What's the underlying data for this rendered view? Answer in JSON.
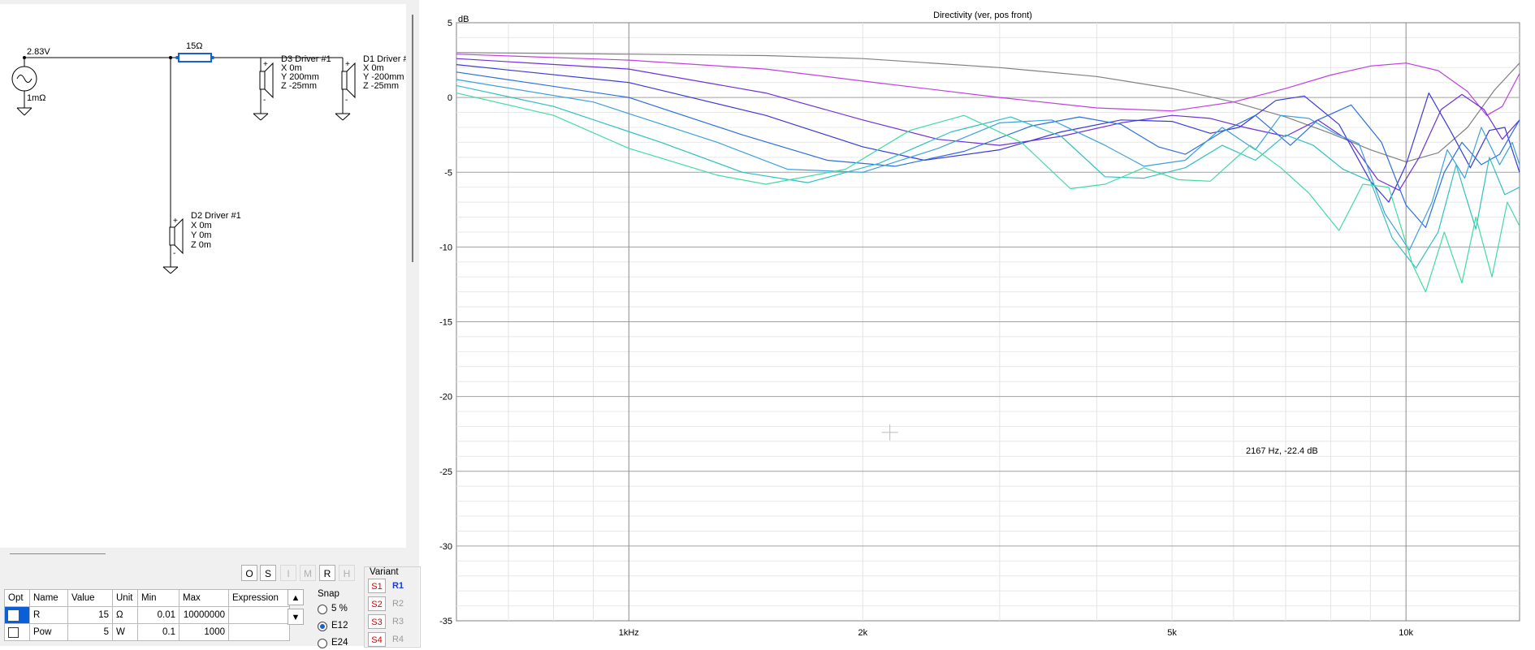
{
  "schematic": {
    "source_voltage": "2.83V",
    "source_resistance": "1mΩ",
    "resistor_label": "15Ω",
    "drivers": [
      {
        "name": "D3 Driver #1",
        "x": "X 0m",
        "y": "Y 200mm",
        "z": "Z -25mm"
      },
      {
        "name": "D1 Driver #",
        "x": "X 0m",
        "y": "Y -200mm",
        "z": "Z -25mm"
      },
      {
        "name": "D2 Driver #1",
        "x": "X 0m",
        "y": "Y 0m",
        "z": "Z 0m"
      }
    ]
  },
  "toolbar": {
    "o": "O",
    "s": "S",
    "i": "I",
    "m": "M",
    "r": "R",
    "h": "H"
  },
  "params": {
    "headers": [
      "Opt",
      "Name",
      "Value",
      "Unit",
      "Min",
      "Max",
      "Expression"
    ],
    "rows": [
      {
        "name": "R",
        "value": "15",
        "unit": "Ω",
        "min": "0.01",
        "max": "10000000",
        "expression": ""
      },
      {
        "name": "Pow",
        "value": "5",
        "unit": "W",
        "min": "0.1",
        "max": "1000",
        "expression": ""
      }
    ]
  },
  "snap": {
    "title": "Snap",
    "opt1": "5 %",
    "opt2": "E12",
    "opt3": "E24",
    "selected": "E12"
  },
  "variant": {
    "title": "Variant",
    "s1": "S1",
    "s2": "S2",
    "s3": "S3",
    "s4": "S4",
    "r1": "R1",
    "r2": "R2",
    "r3": "R3",
    "r4": "R4",
    "current": "R1"
  },
  "colors": {
    "accent": "#0a5fd6",
    "s_label": "#e00000",
    "r_current": "#1a3ed0"
  },
  "chart_data": {
    "type": "line",
    "title": "Directivity (ver, pos front)",
    "ylabel": "dB",
    "xlabel": "",
    "x_scale": "log",
    "xlim": [
      600,
      14000
    ],
    "ylim": [
      -35,
      5
    ],
    "x_ticks": [
      {
        "v": 1000,
        "label": "1kHz"
      },
      {
        "v": 2000,
        "label": "2k"
      },
      {
        "v": 5000,
        "label": "5k"
      },
      {
        "v": 10000,
        "label": "10k"
      }
    ],
    "y_ticks": [
      5,
      0,
      -5,
      -10,
      -15,
      -20,
      -25,
      -30,
      -35
    ],
    "grid": true,
    "cursor_readout": "2167 Hz, -22.4 dB",
    "cursor": {
      "x": 2167,
      "y": -22.4
    },
    "series": [
      {
        "color": "#808080",
        "points": [
          [
            600,
            3.0
          ],
          [
            1000,
            2.9
          ],
          [
            1500,
            2.8
          ],
          [
            2000,
            2.6
          ],
          [
            3000,
            2.0
          ],
          [
            4000,
            1.4
          ],
          [
            5000,
            0.6
          ],
          [
            6000,
            -0.3
          ],
          [
            7000,
            -1.3
          ],
          [
            8000,
            -2.4
          ],
          [
            9000,
            -3.5
          ],
          [
            10000,
            -4.3
          ],
          [
            11000,
            -3.7
          ],
          [
            12000,
            -2.0
          ],
          [
            13000,
            0.5
          ],
          [
            14000,
            2.3
          ]
        ]
      },
      {
        "color": "#c040e0",
        "points": [
          [
            600,
            2.9
          ],
          [
            1000,
            2.5
          ],
          [
            1500,
            1.9
          ],
          [
            2000,
            1.1
          ],
          [
            3000,
            0.0
          ],
          [
            4000,
            -0.7
          ],
          [
            5000,
            -0.9
          ],
          [
            6000,
            -0.3
          ],
          [
            7000,
            0.6
          ],
          [
            8000,
            1.5
          ],
          [
            9000,
            2.1
          ],
          [
            10000,
            2.3
          ],
          [
            11000,
            1.8
          ],
          [
            12000,
            0.4
          ],
          [
            12700,
            -1.2
          ],
          [
            13300,
            -0.6
          ],
          [
            14000,
            1.6
          ]
        ]
      },
      {
        "color": "#7030d8",
        "points": [
          [
            600,
            2.6
          ],
          [
            1000,
            1.9
          ],
          [
            1500,
            0.3
          ],
          [
            2000,
            -1.5
          ],
          [
            2500,
            -2.8
          ],
          [
            3000,
            -3.2
          ],
          [
            3600,
            -2.6
          ],
          [
            4300,
            -1.7
          ],
          [
            5000,
            -1.2
          ],
          [
            5600,
            -1.4
          ],
          [
            6200,
            -2.0
          ],
          [
            7000,
            -2.6
          ],
          [
            7700,
            -1.5
          ],
          [
            8500,
            -3.0
          ],
          [
            9200,
            -5.5
          ],
          [
            9800,
            -6.2
          ],
          [
            10400,
            -4.0
          ],
          [
            11100,
            -0.8
          ],
          [
            11800,
            0.2
          ],
          [
            12600,
            -0.8
          ],
          [
            13300,
            -2.8
          ],
          [
            14000,
            -1.5
          ]
        ]
      },
      {
        "color": "#3a3ad8",
        "points": [
          [
            600,
            2.2
          ],
          [
            1000,
            1.0
          ],
          [
            1500,
            -1.2
          ],
          [
            2000,
            -3.3
          ],
          [
            2400,
            -4.2
          ],
          [
            3000,
            -3.5
          ],
          [
            3600,
            -2.3
          ],
          [
            4300,
            -1.5
          ],
          [
            5000,
            -1.6
          ],
          [
            5600,
            -2.4
          ],
          [
            6100,
            -2.0
          ],
          [
            6800,
            -0.2
          ],
          [
            7400,
            0.1
          ],
          [
            8200,
            -1.8
          ],
          [
            9000,
            -5.6
          ],
          [
            9500,
            -7.0
          ],
          [
            10000,
            -4.5
          ],
          [
            10700,
            0.3
          ],
          [
            11400,
            -2.2
          ],
          [
            12100,
            -4.7
          ],
          [
            12800,
            -2.2
          ],
          [
            13400,
            -2.0
          ],
          [
            14000,
            -5.0
          ]
        ]
      },
      {
        "color": "#2a6ee0",
        "points": [
          [
            600,
            1.7
          ],
          [
            1000,
            0.0
          ],
          [
            1400,
            -2.5
          ],
          [
            1800,
            -4.2
          ],
          [
            2200,
            -4.6
          ],
          [
            2700,
            -3.6
          ],
          [
            3300,
            -1.9
          ],
          [
            3800,
            -1.3
          ],
          [
            4300,
            -1.8
          ],
          [
            4800,
            -3.3
          ],
          [
            5200,
            -3.8
          ],
          [
            5800,
            -2.3
          ],
          [
            6400,
            -1.2
          ],
          [
            7100,
            -3.2
          ],
          [
            7700,
            -1.5
          ],
          [
            8500,
            -0.5
          ],
          [
            9300,
            -3.0
          ],
          [
            10000,
            -7.2
          ],
          [
            10600,
            -8.7
          ],
          [
            11200,
            -5.0
          ],
          [
            11800,
            -3.0
          ],
          [
            12500,
            -4.5
          ],
          [
            13200,
            -3.8
          ],
          [
            14000,
            -1.5
          ]
        ]
      },
      {
        "color": "#3aa0e0",
        "points": [
          [
            600,
            1.2
          ],
          [
            900,
            -0.3
          ],
          [
            1300,
            -3.0
          ],
          [
            1600,
            -4.8
          ],
          [
            2000,
            -5.0
          ],
          [
            2500,
            -3.4
          ],
          [
            3000,
            -1.7
          ],
          [
            3500,
            -1.5
          ],
          [
            4100,
            -3.2
          ],
          [
            4600,
            -4.6
          ],
          [
            5200,
            -4.2
          ],
          [
            5800,
            -2.0
          ],
          [
            6400,
            -3.5
          ],
          [
            6900,
            -1.2
          ],
          [
            7500,
            -1.4
          ],
          [
            8100,
            -2.4
          ],
          [
            8700,
            -3.1
          ],
          [
            9400,
            -7.8
          ],
          [
            10100,
            -10.2
          ],
          [
            10800,
            -7.0
          ],
          [
            11300,
            -3.5
          ],
          [
            11900,
            -5.4
          ],
          [
            12500,
            -2.0
          ],
          [
            13200,
            -4.5
          ],
          [
            13700,
            -3.0
          ],
          [
            14000,
            -4.5
          ]
        ]
      },
      {
        "color": "#30c0c0",
        "points": [
          [
            600,
            0.8
          ],
          [
            800,
            -0.6
          ],
          [
            1100,
            -3.0
          ],
          [
            1400,
            -5.0
          ],
          [
            1700,
            -5.7
          ],
          [
            2100,
            -4.4
          ],
          [
            2600,
            -2.3
          ],
          [
            3100,
            -1.3
          ],
          [
            3600,
            -2.6
          ],
          [
            4100,
            -5.3
          ],
          [
            4600,
            -5.4
          ],
          [
            5200,
            -4.7
          ],
          [
            5800,
            -3.2
          ],
          [
            6400,
            -4.2
          ],
          [
            7000,
            -2.5
          ],
          [
            7600,
            -3.2
          ],
          [
            8300,
            -4.8
          ],
          [
            9000,
            -5.6
          ],
          [
            9600,
            -9.4
          ],
          [
            10300,
            -11.4
          ],
          [
            11000,
            -9.0
          ],
          [
            11600,
            -4.5
          ],
          [
            12300,
            -8.8
          ],
          [
            12800,
            -4.0
          ],
          [
            13400,
            -6.5
          ],
          [
            14000,
            -6.0
          ]
        ]
      },
      {
        "color": "#40dca0",
        "points": [
          [
            600,
            0.3
          ],
          [
            800,
            -1.2
          ],
          [
            1000,
            -3.4
          ],
          [
            1300,
            -5.2
          ],
          [
            1500,
            -5.8
          ],
          [
            1900,
            -4.8
          ],
          [
            2300,
            -2.2
          ],
          [
            2700,
            -1.2
          ],
          [
            3200,
            -3.0
          ],
          [
            3700,
            -6.1
          ],
          [
            4100,
            -5.8
          ],
          [
            4600,
            -4.7
          ],
          [
            5100,
            -5.5
          ],
          [
            5600,
            -5.6
          ],
          [
            6300,
            -3.2
          ],
          [
            6900,
            -4.7
          ],
          [
            7500,
            -6.4
          ],
          [
            8200,
            -8.9
          ],
          [
            8800,
            -5.8
          ],
          [
            9500,
            -6.0
          ],
          [
            10200,
            -11.2
          ],
          [
            10600,
            -13.0
          ],
          [
            11200,
            -9.0
          ],
          [
            11800,
            -12.4
          ],
          [
            12300,
            -8.0
          ],
          [
            12900,
            -12.0
          ],
          [
            13500,
            -7.0
          ],
          [
            14000,
            -8.6
          ]
        ]
      }
    ]
  }
}
